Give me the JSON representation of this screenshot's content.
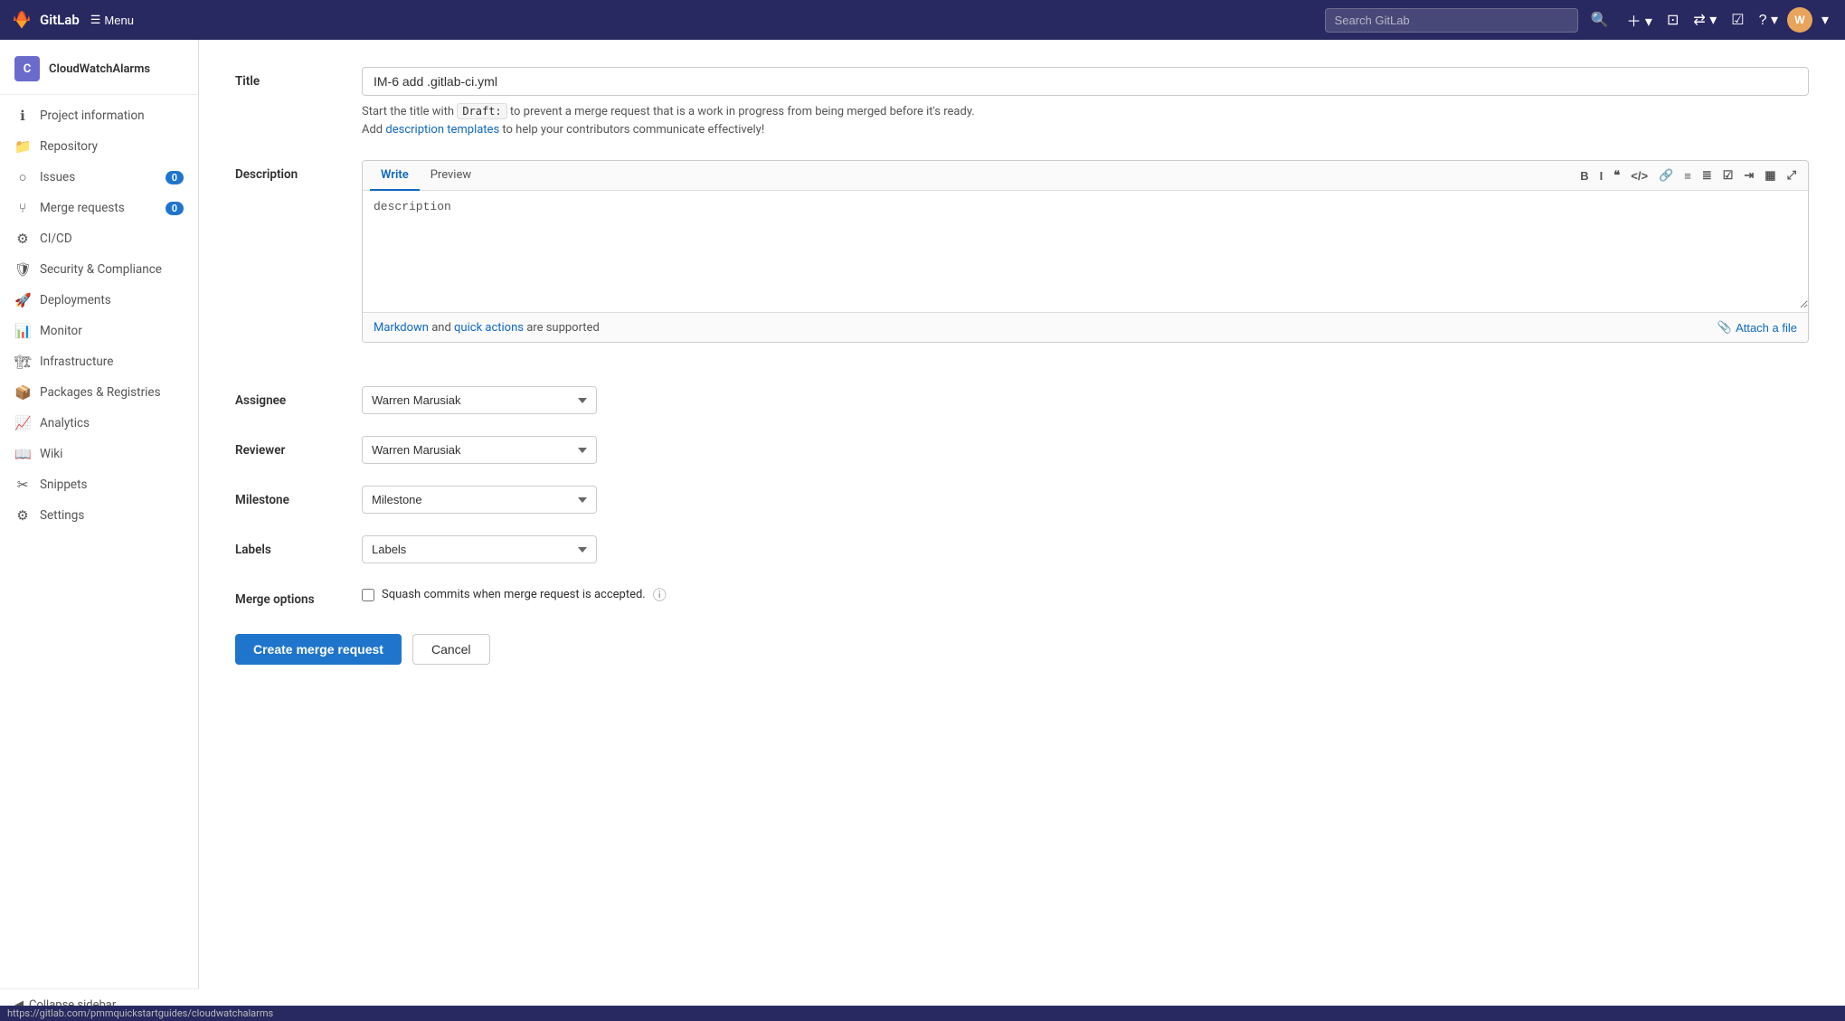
{
  "app": {
    "name": "GitLab",
    "menu_label": "Menu"
  },
  "navbar": {
    "search_placeholder": "Search GitLab",
    "icons": [
      "+",
      "▣",
      "⇄",
      "☑",
      "?",
      "avatar"
    ]
  },
  "sidebar": {
    "project_initial": "C",
    "project_name": "CloudWatchAlarms",
    "items": [
      {
        "id": "project-information",
        "label": "Project information",
        "icon": "ℹ",
        "badge": null
      },
      {
        "id": "repository",
        "label": "Repository",
        "icon": "📁",
        "badge": null
      },
      {
        "id": "issues",
        "label": "Issues",
        "icon": "○",
        "badge": "0"
      },
      {
        "id": "merge-requests",
        "label": "Merge requests",
        "icon": "⑂",
        "badge": "0"
      },
      {
        "id": "cicd",
        "label": "CI/CD",
        "icon": "⚙",
        "badge": null
      },
      {
        "id": "security-compliance",
        "label": "Security & Compliance",
        "icon": "🛡",
        "badge": null
      },
      {
        "id": "deployments",
        "label": "Deployments",
        "icon": "🚀",
        "badge": null
      },
      {
        "id": "monitor",
        "label": "Monitor",
        "icon": "📊",
        "badge": null
      },
      {
        "id": "infrastructure",
        "label": "Infrastructure",
        "icon": "🏗",
        "badge": null
      },
      {
        "id": "packages-registries",
        "label": "Packages & Registries",
        "icon": "📦",
        "badge": null
      },
      {
        "id": "analytics",
        "label": "Analytics",
        "icon": "📈",
        "badge": null
      },
      {
        "id": "wiki",
        "label": "Wiki",
        "icon": "📖",
        "badge": null
      },
      {
        "id": "snippets",
        "label": "Snippets",
        "icon": "✂",
        "badge": null
      },
      {
        "id": "settings",
        "label": "Settings",
        "icon": "⚙",
        "badge": null
      }
    ],
    "collapse_label": "Collapse sidebar"
  },
  "form": {
    "title_label": "Title",
    "title_value": "IM-6 add .gitlab-ci.yml",
    "title_hint_prefix": "Start the title with",
    "title_hint_code": "Draft:",
    "title_hint_suffix": "to prevent a merge request that is a work in progress from being merged before it's ready.",
    "title_hint_add": "Add",
    "title_hint_link": "description templates",
    "title_hint_link_suffix": "to help your contributors communicate effectively!",
    "description_label": "Description",
    "desc_tab_write": "Write",
    "desc_tab_preview": "Preview",
    "desc_placeholder": "description",
    "desc_footer_left1": "Markdown",
    "desc_footer_middle": "and",
    "desc_footer_link": "quick actions",
    "desc_footer_right": "are supported",
    "attach_file_label": "Attach a file",
    "assignee_label": "Assignee",
    "assignee_value": "Warren Marusiak",
    "reviewer_label": "Reviewer",
    "reviewer_value": "Warren Marusiak",
    "milestone_label": "Milestone",
    "milestone_value": "Milestone",
    "labels_label": "Labels",
    "labels_value": "Labels",
    "merge_options_label": "Merge options",
    "merge_options_checkbox": "Squash commits when merge request is accepted.",
    "submit_label": "Create merge request",
    "cancel_label": "Cancel",
    "toolbar": {
      "bold": "B",
      "italic": "I",
      "quote": "\"",
      "code": "<>",
      "link": "🔗",
      "ul": "≡",
      "ol": "≡",
      "task": "☑",
      "indent": "→",
      "table": "▦",
      "fullscreen": "⤢"
    }
  },
  "status_bar": {
    "url": "https://gitlab.com/pmmquickstartguides/cloudwatchalarms"
  }
}
